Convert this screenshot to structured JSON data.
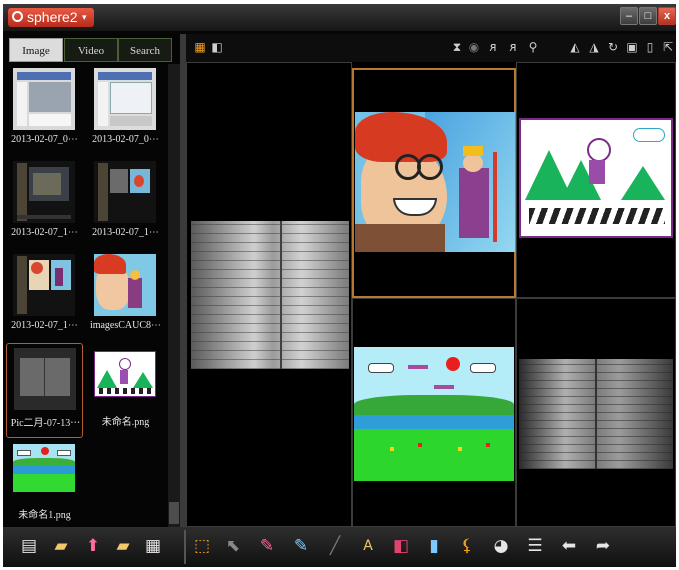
{
  "app": {
    "title": "sphere2",
    "dropdown_caret": "▾",
    "controls": {
      "minimize": "–",
      "maximize": "□",
      "close": "x"
    }
  },
  "sidebar": {
    "tabs": [
      {
        "label": "Image",
        "icon": "",
        "active": true
      },
      {
        "label": "Video",
        "active": false
      },
      {
        "label": "Search",
        "active": false
      }
    ],
    "items": [
      {
        "caption": "2013-02-07_0⋯",
        "thumb": "slide-thumb-icon",
        "selected": false
      },
      {
        "caption": "2013-02-07_0⋯",
        "thumb": "slide-thumb-icon",
        "selected": false
      },
      {
        "caption": "2013-02-07_1⋯",
        "thumb": "app-window-thumb-icon",
        "selected": false
      },
      {
        "caption": "2013-02-07_1⋯",
        "thumb": "app-window-thumb-icon",
        "selected": false
      },
      {
        "caption": "2013-02-07_1⋯",
        "thumb": "app-window-thumb-icon",
        "selected": false
      },
      {
        "caption": "imagesCAUC8⋯",
        "thumb": "cartoon-face-thumb-icon",
        "selected": false
      },
      {
        "caption": "Pic二月-07-13⋯",
        "thumb": "notebook-thumb-icon",
        "selected": true
      },
      {
        "caption": "未命名.png",
        "thumb": "drawing-thumb-icon",
        "selected": false
      },
      {
        "caption": "未命名1.png",
        "thumb": "drawing-thumb-icon",
        "selected": false
      }
    ]
  },
  "top_toolbar": {
    "left_icons": [
      "grid-view-icon",
      "split-view-icon"
    ],
    "right_icons": [
      "hourglass-icon",
      "screen-capture-icon",
      "person-icon",
      "person-icon",
      "zoom-icon",
      "flip-icon",
      "flip-mirror-icon",
      "rotate-icon",
      "fit-icon",
      "export-file-icon",
      "share-icon"
    ]
  },
  "bottom_toolbar": {
    "left_icons": [
      "import-icon",
      "folder-icon",
      "upload-arrow-icon",
      "new-folder-icon",
      "note-icon"
    ],
    "right_icons": [
      "select-pointer-icon",
      "area-select-icon",
      "pen-red-icon",
      "pen-blue-icon",
      "line-icon",
      "text-icon",
      "stamp-icon",
      "highlighter-icon",
      "broom-icon",
      "palette-icon",
      "list-icon",
      "undo-icon",
      "redo-icon"
    ]
  },
  "colors": {
    "accent": "#e15643",
    "selection": "#b8782d",
    "background": "#060606"
  }
}
